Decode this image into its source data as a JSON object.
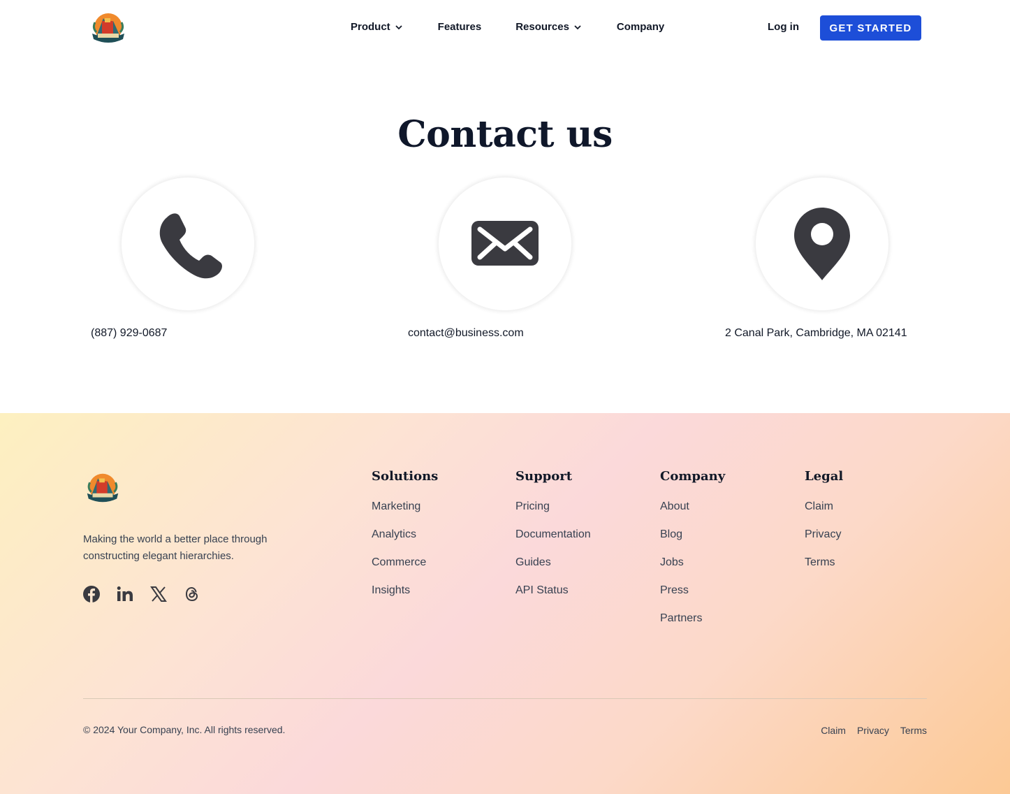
{
  "nav": {
    "logo_alt": "company logo",
    "links": [
      {
        "label": "Product",
        "has_dropdown": true
      },
      {
        "label": "Features",
        "has_dropdown": false
      },
      {
        "label": "Resources",
        "has_dropdown": true
      },
      {
        "label": "Company",
        "has_dropdown": false
      }
    ],
    "login_label": "Log in",
    "cta_label": "GET STARTED",
    "cta_color": "#1d4ed8"
  },
  "contact": {
    "title": "Contact us",
    "items": [
      {
        "icon": "phone-icon",
        "text": "(887) 929-0687"
      },
      {
        "icon": "envelope-icon",
        "text": "contact@business.com"
      },
      {
        "icon": "map-pin-icon",
        "text": "2 Canal Park, Cambridge, MA 02141"
      }
    ],
    "icon_color": "#3a3a40"
  },
  "footer": {
    "tagline": "Making the world a better place through constructing elegant hierarchies.",
    "socials": [
      "facebook-icon",
      "linkedin-icon",
      "x-icon",
      "threads-icon"
    ],
    "columns": [
      {
        "title": "Solutions",
        "links": [
          "Marketing",
          "Analytics",
          "Commerce",
          "Insights"
        ]
      },
      {
        "title": "Support",
        "links": [
          "Pricing",
          "Documentation",
          "Guides",
          "API Status"
        ]
      },
      {
        "title": "Company",
        "links": [
          "About",
          "Blog",
          "Jobs",
          "Press",
          "Partners"
        ]
      },
      {
        "title": "Legal",
        "links": [
          "Claim",
          "Privacy",
          "Terms"
        ]
      }
    ],
    "copyright": "© 2024 Your Company, Inc. All rights reserved.",
    "bottom_links": [
      "Claim",
      "Privacy",
      "Terms"
    ]
  }
}
